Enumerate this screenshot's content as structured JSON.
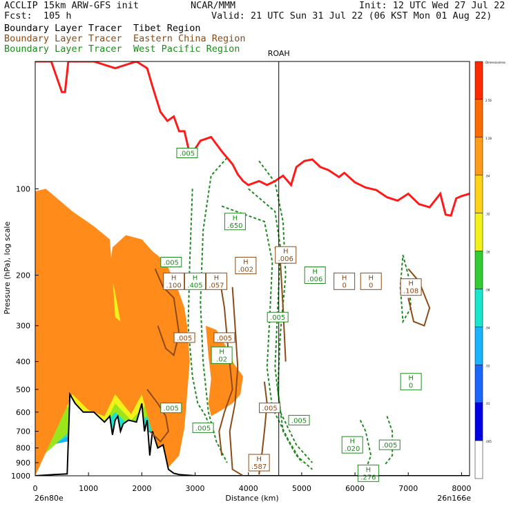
{
  "header": {
    "model": "ACCLIP 15km ARW-GFS init",
    "fcst": "Fcst:  105 h",
    "center": "NCAR/MMM",
    "init": "Init: 12 UTC Wed 27 Jul 22",
    "valid": "Valid: 21 UTC Sun 31 Jul 22 (06 KST Mon 01 Aug 22)"
  },
  "legend": [
    {
      "prefix": "Boundary Layer Tracer",
      "region": "Tibet Region",
      "color": "#000000"
    },
    {
      "prefix": "Boundary Layer Tracer",
      "region": "Eastern China Region",
      "color": "#8b4a16"
    },
    {
      "prefix": "Boundary Layer Tracer",
      "region": "West Pacific Region",
      "color": "#1f8a1f"
    }
  ],
  "chart_data": {
    "type": "cross-section",
    "xlabel": "Distance (km)",
    "ylabel": "Pressure (hPa), log scale",
    "x_ticks": [
      0,
      1000,
      2000,
      3000,
      4000,
      5000,
      6000,
      7000,
      8000
    ],
    "xlim": [
      0,
      8150
    ],
    "y_ticks": [
      100,
      200,
      300,
      400,
      500,
      600,
      700,
      800,
      900,
      1000
    ],
    "ylim": [
      1000,
      36
    ],
    "y_scale": "log",
    "x_left_label": "26n80e",
    "x_right_label": "26n166e",
    "marker": {
      "label": "ROAH",
      "x": 4570
    },
    "colorbar": {
      "labels": [
        "Dimensionless",
        "2.56",
        "1.28",
        ".64",
        ".32",
        ".16",
        ".08",
        ".04",
        ".02",
        ".01",
        ".005"
      ],
      "colors": [
        "#ff2a00",
        "#ff6a00",
        "#ff9a1a",
        "#ffd21a",
        "#f2f21a",
        "#33cc33",
        "#19e6cc",
        "#1ab3ff",
        "#1a66ff",
        "#0000e6",
        "#ffffff"
      ]
    },
    "tropopause": [
      [
        0,
        36
      ],
      [
        300,
        36
      ],
      [
        500,
        46
      ],
      [
        560,
        46
      ],
      [
        620,
        36
      ],
      [
        1100,
        36
      ],
      [
        1500,
        38
      ],
      [
        1900,
        36
      ],
      [
        2100,
        38
      ],
      [
        2200,
        44
      ],
      [
        2350,
        54
      ],
      [
        2480,
        58
      ],
      [
        2600,
        56
      ],
      [
        2700,
        63
      ],
      [
        2800,
        63
      ],
      [
        2880,
        73
      ],
      [
        2950,
        75
      ],
      [
        3100,
        68
      ],
      [
        3300,
        66
      ],
      [
        3500,
        74
      ],
      [
        3700,
        82
      ],
      [
        3800,
        89
      ],
      [
        3900,
        94
      ],
      [
        4000,
        97
      ],
      [
        4200,
        94
      ],
      [
        4350,
        97
      ],
      [
        4500,
        94
      ],
      [
        4650,
        90
      ],
      [
        4800,
        97
      ],
      [
        4900,
        84
      ],
      [
        5050,
        80
      ],
      [
        5200,
        79
      ],
      [
        5350,
        84
      ],
      [
        5500,
        86
      ],
      [
        5700,
        91
      ],
      [
        5800,
        88
      ],
      [
        6000,
        95
      ],
      [
        6200,
        99
      ],
      [
        6400,
        101
      ],
      [
        6600,
        107
      ],
      [
        6800,
        110
      ],
      [
        7000,
        104
      ],
      [
        7200,
        113
      ],
      [
        7400,
        116
      ],
      [
        7600,
        104
      ],
      [
        7700,
        123
      ],
      [
        7800,
        124
      ],
      [
        7900,
        108
      ],
      [
        8000,
        106
      ],
      [
        8150,
        104
      ]
    ],
    "terrain": [
      [
        0,
        1000
      ],
      [
        350,
        990
      ],
      [
        600,
        985
      ],
      [
        650,
        520
      ],
      [
        750,
        560
      ],
      [
        900,
        600
      ],
      [
        1100,
        600
      ],
      [
        1300,
        650
      ],
      [
        1400,
        620
      ],
      [
        1450,
        720
      ],
      [
        1500,
        640
      ],
      [
        1550,
        620
      ],
      [
        1600,
        700
      ],
      [
        1650,
        660
      ],
      [
        1750,
        640
      ],
      [
        1900,
        650
      ],
      [
        2000,
        560
      ],
      [
        2050,
        700
      ],
      [
        2100,
        640
      ],
      [
        2150,
        850
      ],
      [
        2200,
        700
      ],
      [
        2300,
        800
      ],
      [
        2400,
        780
      ],
      [
        2500,
        950
      ],
      [
        2600,
        980
      ],
      [
        2700,
        990
      ],
      [
        3000,
        1000
      ],
      [
        8150,
        1000
      ]
    ],
    "regions": [
      {
        "level": ".64",
        "poly": [
          [
            0,
            102
          ],
          [
            200,
            100
          ],
          [
            700,
            120
          ],
          [
            1100,
            135
          ],
          [
            1400,
            150
          ],
          [
            1450,
            200
          ],
          [
            1500,
            280
          ],
          [
            1600,
            290
          ],
          [
            1500,
            230
          ],
          [
            1400,
            190
          ],
          [
            1450,
            160
          ],
          [
            1700,
            145
          ],
          [
            2000,
            150
          ],
          [
            2200,
            165
          ],
          [
            2450,
            180
          ],
          [
            2700,
            230
          ],
          [
            2800,
            260
          ],
          [
            2850,
            300
          ],
          [
            2900,
            400
          ],
          [
            2850,
            520
          ],
          [
            2800,
            680
          ],
          [
            2700,
            850
          ],
          [
            2400,
            980
          ],
          [
            2000,
            520
          ],
          [
            1800,
            610
          ],
          [
            1500,
            520
          ],
          [
            1300,
            620
          ],
          [
            1000,
            590
          ],
          [
            700,
            520
          ],
          [
            0,
            1000
          ]
        ]
      },
      {
        "level": ".32",
        "poly": [
          [
            0,
            106
          ],
          [
            200,
            104
          ],
          [
            600,
            125
          ],
          [
            1000,
            140
          ],
          [
            1300,
            160
          ],
          [
            1350,
            200
          ],
          [
            1400,
            260
          ],
          [
            1350,
            210
          ],
          [
            1600,
            152
          ],
          [
            1900,
            158
          ],
          [
            2150,
            175
          ],
          [
            2400,
            190
          ],
          [
            2600,
            240
          ],
          [
            2750,
            300
          ],
          [
            2800,
            400
          ],
          [
            2750,
            520
          ],
          [
            2700,
            680
          ],
          [
            2600,
            820
          ],
          [
            2400,
            940
          ],
          [
            2100,
            560
          ],
          [
            1800,
            640
          ],
          [
            1500,
            560
          ],
          [
            1300,
            660
          ],
          [
            900,
            620
          ],
          [
            500,
            560
          ],
          [
            0,
            960
          ]
        ]
      },
      {
        "level": ".16",
        "poly": [
          [
            0,
            112
          ],
          [
            500,
            132
          ],
          [
            900,
            150
          ],
          [
            1200,
            175
          ],
          [
            1250,
            230
          ],
          [
            1550,
            160
          ],
          [
            1900,
            168
          ],
          [
            2200,
            190
          ],
          [
            2500,
            215
          ],
          [
            2650,
            300
          ],
          [
            2700,
            400
          ],
          [
            2650,
            520
          ],
          [
            2550,
            650
          ],
          [
            2350,
            860
          ],
          [
            2100,
            620
          ],
          [
            1800,
            680
          ],
          [
            1500,
            600
          ],
          [
            1200,
            700
          ],
          [
            800,
            660
          ],
          [
            0,
            900
          ]
        ]
      },
      {
        "level": ".08",
        "poly": [
          [
            0,
            120
          ],
          [
            600,
            142
          ],
          [
            1100,
            175
          ],
          [
            1150,
            220
          ],
          [
            1600,
            175
          ],
          [
            2100,
            200
          ],
          [
            2400,
            240
          ],
          [
            2550,
            320
          ],
          [
            2600,
            420
          ],
          [
            2500,
            560
          ],
          [
            2300,
            770
          ],
          [
            2050,
            660
          ],
          [
            1700,
            720
          ],
          [
            1300,
            740
          ],
          [
            800,
            700
          ],
          [
            0,
            840
          ]
        ]
      },
      {
        "level": ".04",
        "poly": [
          [
            0,
            130
          ],
          [
            700,
            155
          ],
          [
            1050,
            200
          ],
          [
            1800,
            200
          ],
          [
            2200,
            230
          ],
          [
            2450,
            300
          ],
          [
            2450,
            420
          ],
          [
            2350,
            560
          ],
          [
            2200,
            700
          ],
          [
            1900,
            720
          ],
          [
            1400,
            760
          ],
          [
            900,
            740
          ],
          [
            0,
            800
          ]
        ]
      },
      {
        "level": ".02",
        "poly": [
          [
            0,
            150
          ],
          [
            600,
            180
          ],
          [
            1000,
            240
          ],
          [
            1800,
            250
          ],
          [
            2200,
            300
          ],
          [
            2300,
            420
          ],
          [
            2200,
            560
          ],
          [
            2000,
            700
          ],
          [
            1500,
            760
          ],
          [
            900,
            760
          ],
          [
            0,
            760
          ]
        ]
      },
      {
        "level": ".01",
        "poly": [
          [
            0,
            175
          ],
          [
            500,
            200
          ],
          [
            900,
            280
          ],
          [
            1700,
            300
          ],
          [
            2100,
            380
          ],
          [
            2150,
            500
          ],
          [
            1900,
            640
          ],
          [
            1400,
            720
          ],
          [
            800,
            720
          ],
          [
            0,
            720
          ]
        ]
      },
      {
        "level": ".64",
        "poly": [
          [
            3200,
            300
          ],
          [
            3400,
            310
          ],
          [
            3600,
            360
          ],
          [
            3700,
            400
          ],
          [
            3900,
            450
          ],
          [
            3850,
            520
          ],
          [
            3700,
            560
          ],
          [
            3500,
            590
          ],
          [
            3300,
            620
          ],
          [
            3250,
            560
          ],
          [
            3300,
            460
          ],
          [
            3250,
            380
          ]
        ]
      },
      {
        "level": ".32",
        "poly": [
          [
            3300,
            320
          ],
          [
            3500,
            340
          ],
          [
            3700,
            390
          ],
          [
            3800,
            450
          ],
          [
            3750,
            510
          ],
          [
            3600,
            550
          ],
          [
            3450,
            575
          ],
          [
            3350,
            570
          ],
          [
            3350,
            460
          ],
          [
            3330,
            380
          ]
        ]
      },
      {
        "level": ".16",
        "poly": [
          [
            3400,
            340
          ],
          [
            3600,
            370
          ],
          [
            3700,
            420
          ],
          [
            3700,
            490
          ],
          [
            3550,
            530
          ],
          [
            3420,
            540
          ],
          [
            3420,
            450
          ]
        ]
      },
      {
        "level": ".08",
        "poly": [
          [
            3450,
            360
          ],
          [
            3600,
            390
          ],
          [
            3650,
            440
          ],
          [
            3600,
            500
          ],
          [
            3480,
            510
          ],
          [
            3460,
            440
          ]
        ]
      }
    ],
    "boxes": [
      {
        "text": ".005",
        "x": 2850,
        "y": 75,
        "color": "#1f8a1f"
      },
      {
        "text": ".650",
        "x": 3750,
        "y": 130,
        "color": "#1f8a1f",
        "h": true
      },
      {
        "text": ".005",
        "x": 2550,
        "y": 180,
        "color": "#1f8a1f"
      },
      {
        "text": ".002",
        "x": 3950,
        "y": 185,
        "color": "#8b4a16",
        "h": true
      },
      {
        "text": ".006",
        "x": 4700,
        "y": 170,
        "color": "#8b4a16",
        "h": true
      },
      {
        "text": ".006",
        "x": 5250,
        "y": 200,
        "color": "#1f8a1f",
        "h": true
      },
      {
        "text": "0",
        "x": 5800,
        "y": 210,
        "color": "#8b4a16",
        "h": true
      },
      {
        "text": "0",
        "x": 6300,
        "y": 210,
        "color": "#8b4a16",
        "h": true
      },
      {
        "text": ".108",
        "x": 7050,
        "y": 220,
        "color": "#8b4a16",
        "h": true
      },
      {
        "text": ".100",
        "x": 2600,
        "y": 210,
        "color": "#8b4a16",
        "h": true
      },
      {
        "text": ".405",
        "x": 3000,
        "y": 210,
        "color": "#1f8a1f",
        "h": true
      },
      {
        "text": ".057",
        "x": 3400,
        "y": 210,
        "color": "#8b4a16",
        "h": true
      },
      {
        "text": ".005",
        "x": 4550,
        "y": 280,
        "color": "#1f8a1f"
      },
      {
        "text": ".005",
        "x": 2800,
        "y": 330,
        "color": "#8b4a16"
      },
      {
        "text": ".005",
        "x": 3550,
        "y": 330,
        "color": "#8b4a16"
      },
      {
        "text": ".02",
        "x": 3500,
        "y": 380,
        "color": "#1f8a1f",
        "h": true
      },
      {
        "text": "0",
        "x": 7050,
        "y": 470,
        "color": "#1f8a1f",
        "h": true
      },
      {
        "text": ".005",
        "x": 4400,
        "y": 580,
        "color": "#8b4a16"
      },
      {
        "text": ".005",
        "x": 4950,
        "y": 640,
        "color": "#1f8a1f"
      },
      {
        "text": ".005",
        "x": 2550,
        "y": 580,
        "color": "#1f8a1f"
      },
      {
        "text": ".005",
        "x": 3150,
        "y": 680,
        "color": "#1f8a1f"
      },
      {
        "text": ".020",
        "x": 5950,
        "y": 780,
        "color": "#1f8a1f",
        "h": true
      },
      {
        "text": ".005",
        "x": 6650,
        "y": 780,
        "color": "#1f8a1f"
      },
      {
        "text": ".587",
        "x": 4200,
        "y": 900,
        "color": "#8b4a16",
        "h": true
      },
      {
        "text": ".276",
        "x": 6250,
        "y": 980,
        "color": "#1f8a1f",
        "h": true
      }
    ]
  }
}
